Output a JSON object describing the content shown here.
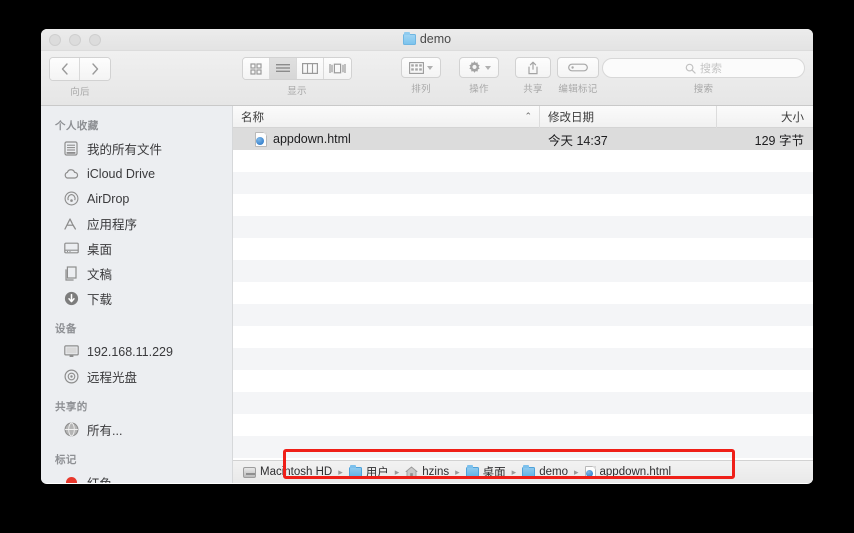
{
  "window": {
    "title": "demo",
    "title_icon": "folder-icon",
    "traffic_lights": [
      {
        "name": "close-button",
        "color": "#dcdcdc"
      },
      {
        "name": "minimize-button",
        "color": "#dcdcdc"
      },
      {
        "name": "zoom-button",
        "color": "#dcdcdc"
      }
    ]
  },
  "toolbar": {
    "nav": {
      "back_icon": "chevron-left-icon",
      "forward_icon": "chevron-right-icon",
      "label": "向后"
    },
    "view": {
      "label": "显示",
      "options": [
        {
          "name": "icon-view",
          "icon": "grid-icon",
          "selected": false
        },
        {
          "name": "list-view",
          "icon": "list-icon",
          "selected": true
        },
        {
          "name": "column-view",
          "icon": "columns-icon",
          "selected": false
        },
        {
          "name": "coverflow-view",
          "icon": "coverflow-icon",
          "selected": false
        }
      ]
    },
    "arrange": {
      "label": "排列",
      "icon": "arrange-grid-icon",
      "chevron": "chevron-down-icon"
    },
    "action": {
      "label": "操作",
      "icon": "gear-icon",
      "chevron": "chevron-down-icon"
    },
    "share": {
      "label": "共享",
      "icon": "share-upload-icon"
    },
    "tags": {
      "label": "编辑标记",
      "icon": "tag-icon"
    },
    "search": {
      "label": "搜索",
      "placeholder": "搜索",
      "icon": "search-icon",
      "value": ""
    }
  },
  "sidebar": {
    "sections": [
      {
        "header": "个人收藏",
        "items": [
          {
            "label": "我的所有文件",
            "icon": "all-files-icon"
          },
          {
            "label": "iCloud Drive",
            "icon": "cloud-icon"
          },
          {
            "label": "AirDrop",
            "icon": "airdrop-icon"
          },
          {
            "label": "应用程序",
            "icon": "applications-icon"
          },
          {
            "label": "桌面",
            "icon": "desktop-icon"
          },
          {
            "label": "文稿",
            "icon": "documents-icon"
          },
          {
            "label": "下载",
            "icon": "downloads-icon"
          }
        ]
      },
      {
        "header": "设备",
        "items": [
          {
            "label": "192.168.11.229",
            "icon": "computer-icon"
          },
          {
            "label": "远程光盘",
            "icon": "disc-icon"
          }
        ]
      },
      {
        "header": "共享的",
        "items": [
          {
            "label": "所有...",
            "icon": "network-globe-icon"
          }
        ]
      },
      {
        "header": "标记",
        "items": [
          {
            "label": "红色",
            "icon": "red-tag-icon",
            "color": "#e8382c"
          }
        ]
      }
    ]
  },
  "filelist": {
    "columns": [
      {
        "key": "name",
        "label": "名称",
        "sorted": true,
        "sort_caret": "⌃"
      },
      {
        "key": "date",
        "label": "修改日期"
      },
      {
        "key": "size",
        "label": "大小"
      }
    ],
    "rows": [
      {
        "name": "appdown.html",
        "date": "今天 14:37",
        "size": "129 字节",
        "icon": "html-file-icon",
        "selected": true
      }
    ],
    "empty_row_count": 14
  },
  "pathbar": {
    "crumbs": [
      {
        "label": "Macintosh HD",
        "icon": "harddisk-icon"
      },
      {
        "label": "用户",
        "icon": "folder-icon"
      },
      {
        "label": "hzins",
        "icon": "home-icon"
      },
      {
        "label": "桌面",
        "icon": "folder-icon"
      },
      {
        "label": "demo",
        "icon": "folder-icon"
      },
      {
        "label": "appdown.html",
        "icon": "html-file-icon"
      }
    ],
    "separator": "▸"
  },
  "annotation": {
    "type": "rectangle-highlight",
    "color": "#ef1f18"
  }
}
